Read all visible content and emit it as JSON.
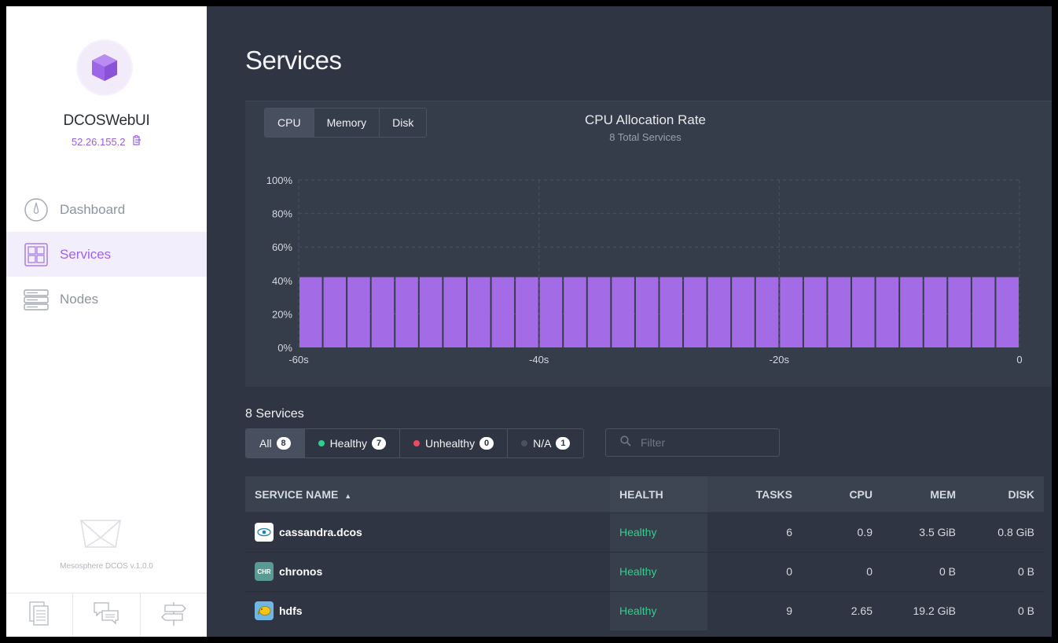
{
  "sidebar": {
    "cluster_name": "DCOSWebUI",
    "cluster_ip": "52.26.155.2",
    "nav": [
      {
        "label": "Dashboard",
        "icon": "dashboard-icon"
      },
      {
        "label": "Services",
        "icon": "services-grid-icon"
      },
      {
        "label": "Nodes",
        "icon": "nodes-server-icon"
      }
    ],
    "version": "Mesosphere DCOS v.1.0.0",
    "bottom_icons": [
      "docs-icon",
      "chat-icon",
      "signpost-icon"
    ]
  },
  "page": {
    "title": "Services"
  },
  "chart": {
    "tabs": [
      "CPU",
      "Memory",
      "Disk"
    ],
    "active_tab": "CPU",
    "title": "CPU Allocation Rate",
    "subtitle": "8 Total Services"
  },
  "chart_data": {
    "type": "bar",
    "title": "CPU Allocation Rate",
    "subtitle": "8 Total Services",
    "bar_color": "#a36ce6",
    "y_ticks": [
      "100%",
      "80%",
      "60%",
      "40%",
      "20%",
      "0%"
    ],
    "x_ticks": [
      "-60s",
      "-40s",
      "-20s",
      "0"
    ],
    "ylim": [
      0,
      100
    ],
    "xlim": [
      -60,
      0
    ],
    "x": [
      -60,
      -58,
      -56,
      -54,
      -52,
      -50,
      -48,
      -46,
      -44,
      -42,
      -40,
      -38,
      -36,
      -34,
      -32,
      -30,
      -28,
      -26,
      -24,
      -22,
      -20,
      -18,
      -16,
      -14,
      -12,
      -10,
      -8,
      -6,
      -4,
      -2
    ],
    "values": [
      42,
      42,
      42,
      42,
      42,
      42,
      42,
      42,
      42,
      42,
      42,
      42,
      42,
      42,
      42,
      42,
      42,
      42,
      42,
      42,
      42,
      42,
      42,
      42,
      42,
      42,
      42,
      42,
      42,
      42
    ],
    "grid": true
  },
  "services": {
    "count_label": "8 Services",
    "filters": [
      {
        "label": "All",
        "count": "8",
        "dot": null
      },
      {
        "label": "Healthy",
        "count": "7",
        "dot": "#2bd18c"
      },
      {
        "label": "Unhealthy",
        "count": "0",
        "dot": "#ef4a5d"
      },
      {
        "label": "N/A",
        "count": "1",
        "dot": "#4a5262"
      }
    ],
    "filter_placeholder": "Filter",
    "columns": {
      "name": "SERVICE NAME",
      "health": "HEALTH",
      "tasks": "TASKS",
      "cpu": "CPU",
      "mem": "MEM",
      "disk": "DISK"
    },
    "rows": [
      {
        "name": "cassandra.dcos",
        "icon": "cassandra-eye-icon",
        "health": "Healthy",
        "tasks": "6",
        "cpu": "0.9",
        "mem": "3.5 GiB",
        "disk": "0.8 GiB"
      },
      {
        "name": "chronos",
        "icon": "chronos-icon",
        "icon_text": "CHR",
        "health": "Healthy",
        "tasks": "0",
        "cpu": "0",
        "mem": "0 B",
        "disk": "0 B"
      },
      {
        "name": "hdfs",
        "icon": "hdfs-elephant-icon",
        "health": "Healthy",
        "tasks": "9",
        "cpu": "2.65",
        "mem": "19.2 GiB",
        "disk": "0 B"
      }
    ]
  }
}
